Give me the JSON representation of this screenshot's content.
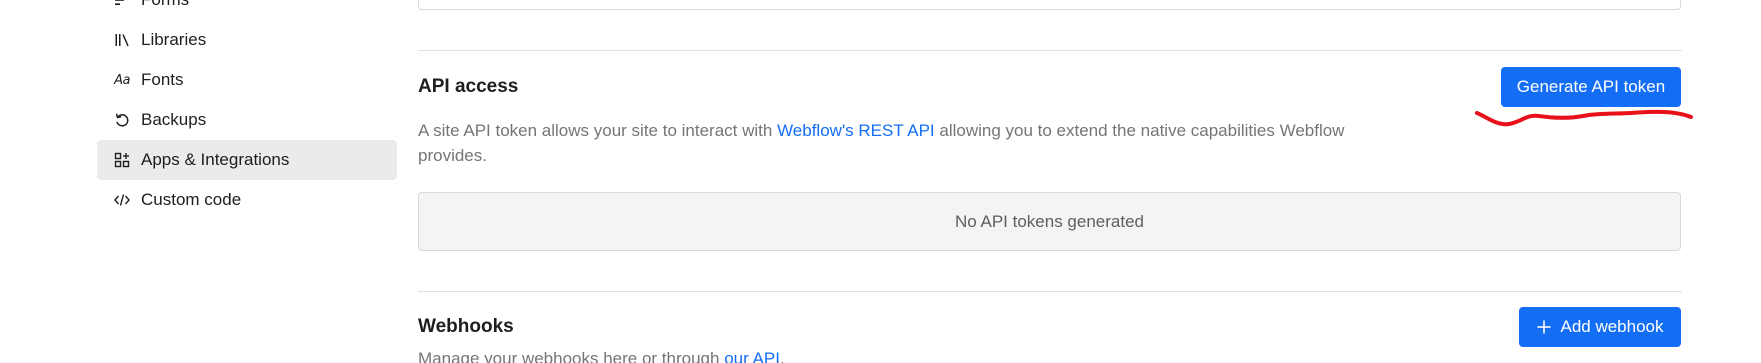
{
  "sidebar": {
    "items": [
      {
        "label": "Forms",
        "icon": "forms-icon",
        "active": false
      },
      {
        "label": "Libraries",
        "icon": "libraries-icon",
        "active": false
      },
      {
        "label": "Fonts",
        "icon": "fonts-icon",
        "active": false
      },
      {
        "label": "Backups",
        "icon": "backups-icon",
        "active": false
      },
      {
        "label": "Apps & Integrations",
        "icon": "apps-icon",
        "active": true
      },
      {
        "label": "Custom code",
        "icon": "code-icon",
        "active": false
      }
    ],
    "fonts_icon_text": "Aa"
  },
  "api_access": {
    "title": "API access",
    "button_label": "Generate API token",
    "description_before": "A site API token allows your site to interact with ",
    "description_link": "Webflow's REST API",
    "description_after": " allowing you to extend the native capabilities Webflow provides.",
    "empty_state": "No API tokens generated"
  },
  "webhooks": {
    "title": "Webhooks",
    "button_label": "Add webhook",
    "description_before": "Manage your webhooks here or through ",
    "description_link": "our API",
    "description_after": "."
  },
  "colors": {
    "accent": "#146ef5",
    "annotation": "#e8101a",
    "active_nav_bg": "#ebebeb"
  }
}
